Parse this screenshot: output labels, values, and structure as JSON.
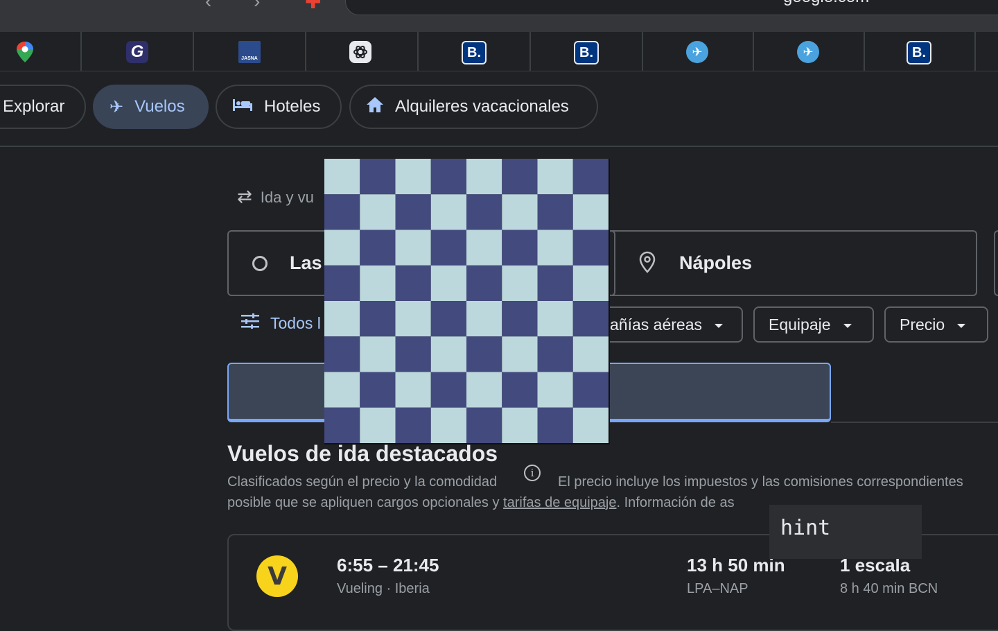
{
  "browser": {
    "domain": "google.com",
    "bookmarks": [
      {
        "icon": "google-maps-icon",
        "label": ""
      },
      {
        "icon": "grammarly-icon",
        "label": "G"
      },
      {
        "icon": "jasna-icon",
        "label": "JASNA"
      },
      {
        "icon": "chatgpt-icon",
        "label": ""
      },
      {
        "icon": "booking-icon",
        "label": "B."
      },
      {
        "icon": "booking-icon",
        "label": "B."
      },
      {
        "icon": "plane-icon",
        "label": "✈"
      },
      {
        "icon": "plane-icon",
        "label": "✈"
      },
      {
        "icon": "booking-icon",
        "label": "B."
      }
    ]
  },
  "tabs": {
    "explore": "Explorar",
    "flights": "Vuelos",
    "hotels": "Hoteles",
    "rentals": "Alquileres vacacionales"
  },
  "search": {
    "trip_type": "Ida y vu",
    "origin": "Las",
    "destination": "Nápoles",
    "all_filters": "Todos l",
    "airlines_filter": "añías aéreas",
    "baggage_filter": "Equipaje",
    "price_filter": "Precio"
  },
  "results": {
    "title": "Vuelos de ida destacados",
    "sorted_by": "Clasificados según el precio y la comodidad",
    "price_note": "El precio incluye los impuestos y las comisiones correspondientes",
    "fees_pre": "posible que se apliquen cargos opcionales y ",
    "fees_link": "tarifas de equipaje",
    "fees_post": ". Información de as",
    "fees_end": "."
  },
  "tooltip": {
    "text": "hint"
  },
  "flight": {
    "airline_logo_letter": "V",
    "times": "6:55 – 21:45",
    "airlines": "Vueling · Iberia",
    "duration": "13 h 50 min",
    "route": "LPA–NAP",
    "stops": "1 escala",
    "layover": "8 h 40 min BCN"
  },
  "colors": {
    "accent": "#a8c7fa",
    "checker_dark": "#434a7e",
    "checker_light": "#bcd8dc",
    "vueling_yellow": "#f7d31b"
  }
}
